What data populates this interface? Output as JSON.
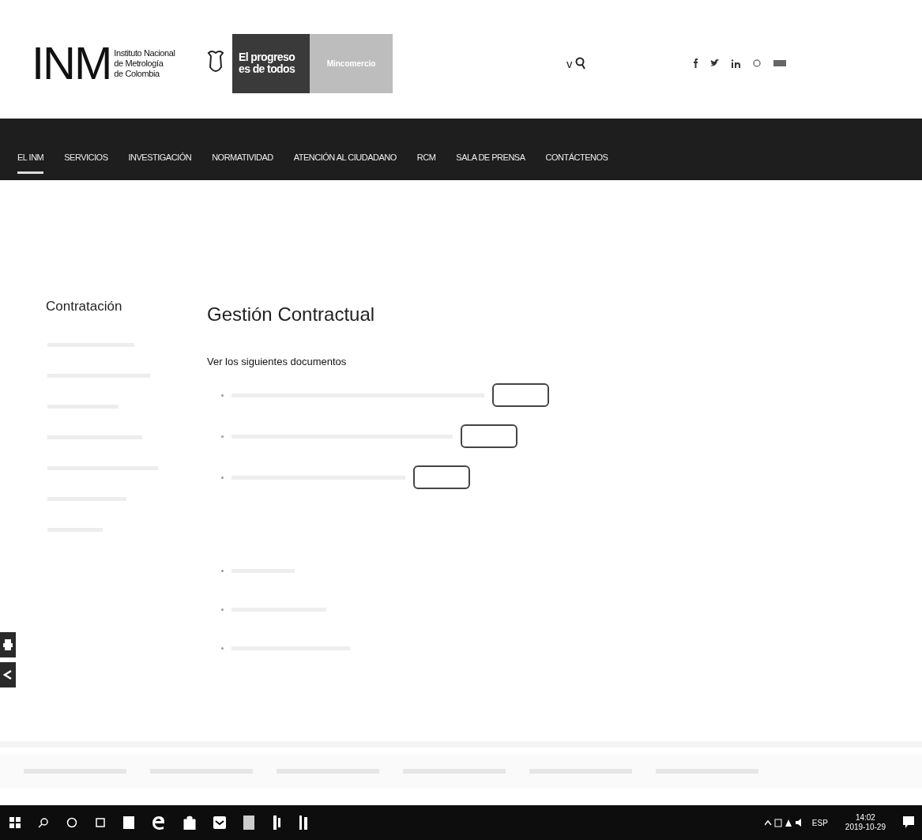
{
  "header": {
    "logo": {
      "acronym": "INM",
      "name_lines": [
        "Instituto Nacional",
        "de Metrología",
        "de Colombia"
      ]
    },
    "slogan": [
      "El progreso",
      "es de todos"
    ],
    "ministry": "Mincomercio",
    "toggle": "v"
  },
  "nav": {
    "items": [
      {
        "label": "EL INM",
        "selected": true
      },
      {
        "label": "SERVICIOS",
        "selected": false
      },
      {
        "label": "INVESTIGACIÓN",
        "selected": false
      },
      {
        "label": "NORMATIVIDAD",
        "selected": false
      },
      {
        "label": "ATENCIÓN AL CIUDADANO",
        "selected": false
      },
      {
        "label": "RCM",
        "selected": false
      },
      {
        "label": "SALA DE PRENSA",
        "selected": false
      },
      {
        "label": "CONTÁCTENOS",
        "selected": false
      }
    ]
  },
  "sidebar": {
    "title": "Contratación"
  },
  "main": {
    "title": "Gestión Contractual",
    "intro": "Ver los siguientes documentos"
  },
  "taskbar": {
    "language": "ESP",
    "time": "14:02",
    "date": "2019-10-29"
  }
}
